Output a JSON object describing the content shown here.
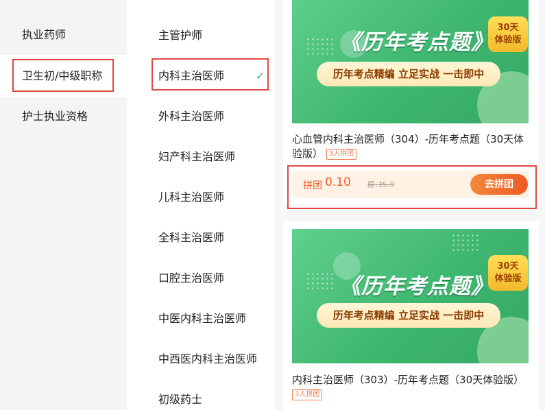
{
  "left_nav": {
    "items": [
      {
        "label": "执业药师",
        "active": false
      },
      {
        "label": "卫生初/中级职称",
        "active": true
      },
      {
        "label": "护士执业资格",
        "active": false
      }
    ]
  },
  "sub_nav": {
    "items": [
      {
        "label": "主管护师"
      },
      {
        "label": "内科主治医师",
        "selected": true
      },
      {
        "label": "外科主治医师"
      },
      {
        "label": "妇产科主治医师"
      },
      {
        "label": "儿科主治医师"
      },
      {
        "label": "全科主治医师"
      },
      {
        "label": "口腔主治医师"
      },
      {
        "label": "中医内科主治医师"
      },
      {
        "label": "中西医内科主治医师"
      },
      {
        "label": "初级药士"
      }
    ],
    "check_icon": "check-icon"
  },
  "courses": [
    {
      "banner": {
        "title": "《历年考点题》",
        "slogan": "历年考点精编  立足实战  一击即中",
        "badge_line1": "30天",
        "badge_line2": "体验版"
      },
      "title": "心血管内科主治医师（304）-历年考点题（30天体验版）",
      "group_tag": "3人拼团",
      "price_label": "拼团",
      "price": "0.10",
      "original_price": "原:35.9",
      "join_button": "去拼团"
    },
    {
      "banner": {
        "title": "《历年考点题》",
        "slogan": "历年考点精编  立足实战  一击即中",
        "badge_line1": "30天",
        "badge_line2": "体验版"
      },
      "title": "内科主治医师（303）-历年考点题（30天体验版）",
      "group_tag": "3人拼团"
    }
  ],
  "colors": {
    "accent_green": "#3cb371",
    "price_orange": "#f25c2b",
    "highlight_red": "#e2473f"
  }
}
